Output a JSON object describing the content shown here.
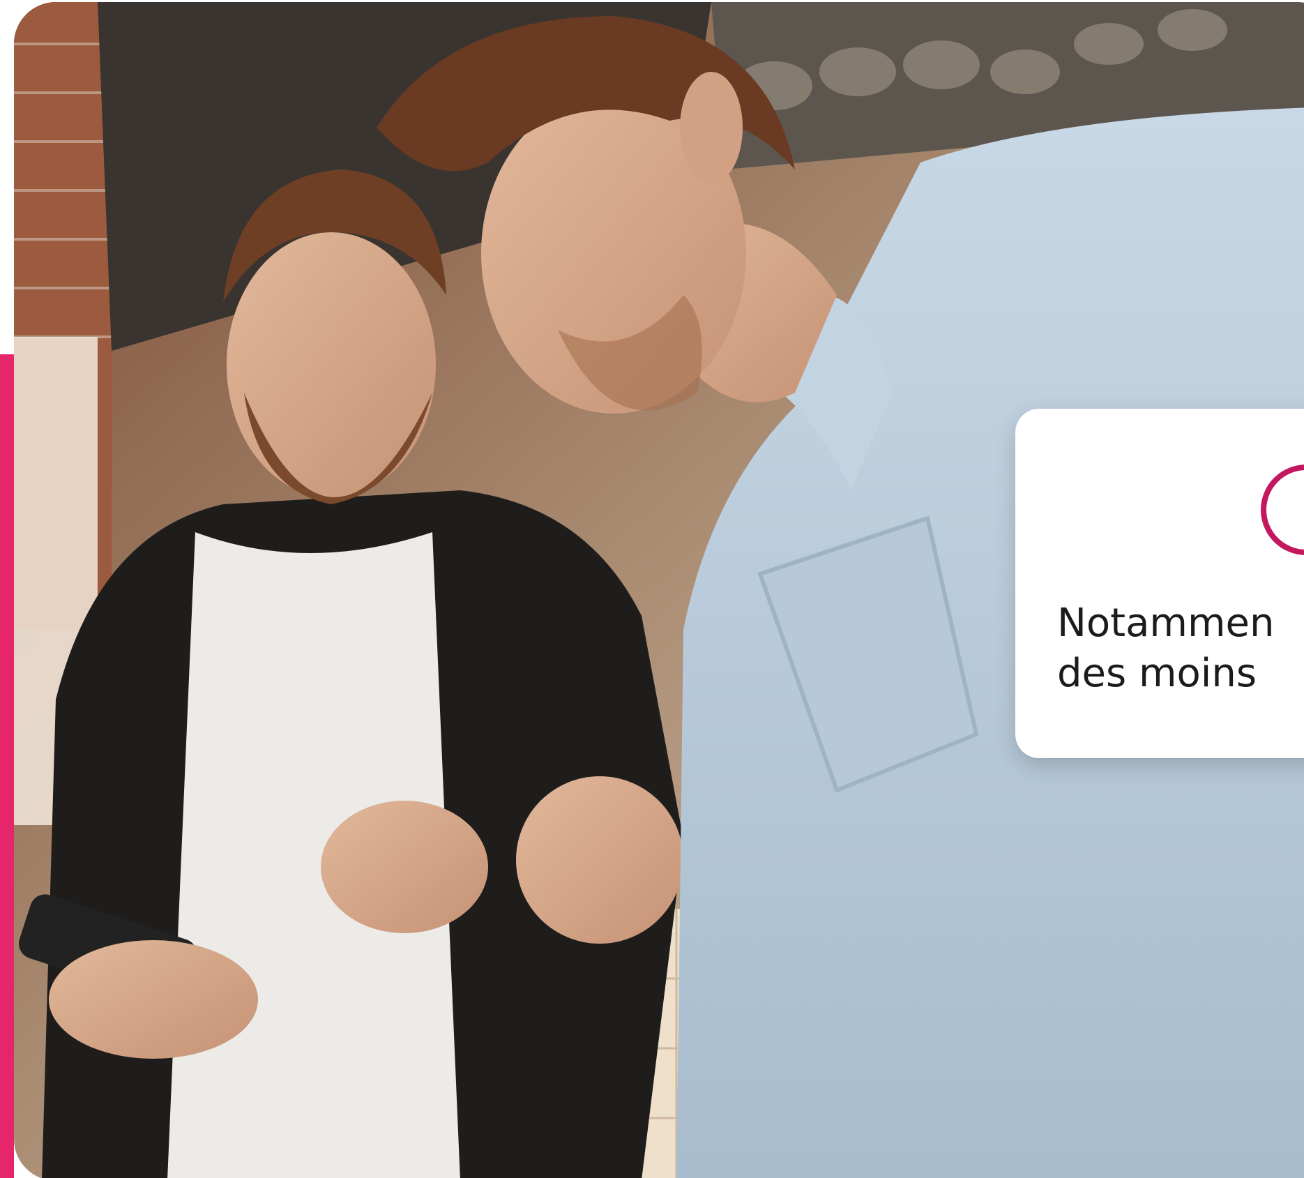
{
  "card": {
    "line1": "Notammen",
    "line2": "des moins"
  },
  "colors": {
    "accent": "#e6266b",
    "icon": "#c3185f",
    "card_background": "#ffffff"
  },
  "photo": {
    "subject": "two-men-looking-at-smartphone-in-cafe"
  }
}
